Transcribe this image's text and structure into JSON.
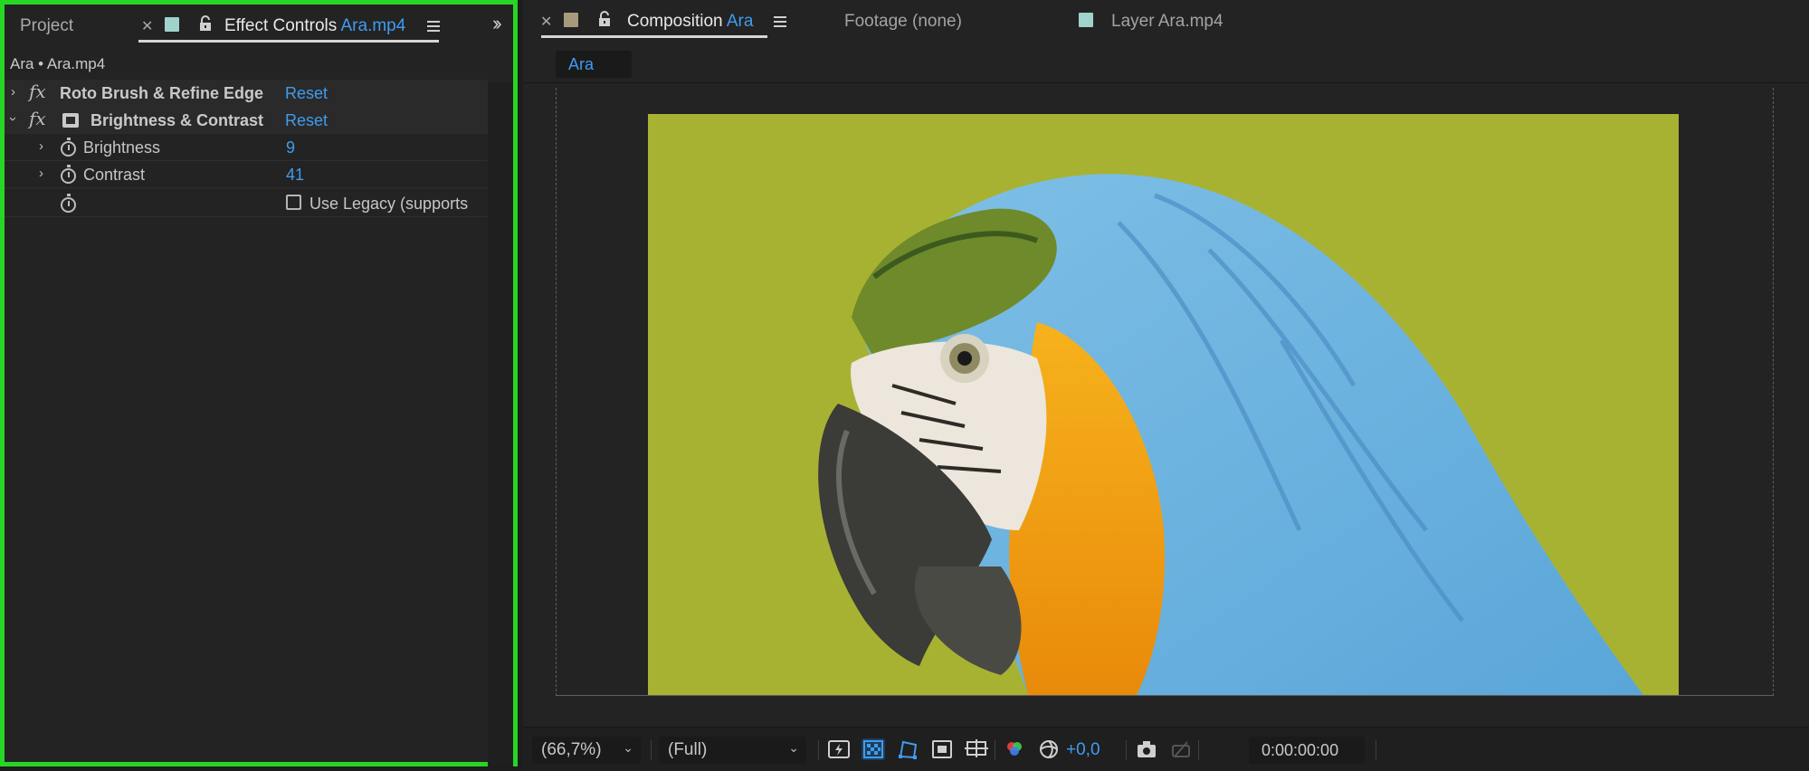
{
  "left_panel": {
    "project_tab": "Project",
    "active_tab": {
      "label": "Effect Controls",
      "file": "Ara.mp4"
    },
    "subject": "Ara • Ara.mp4",
    "effects": [
      {
        "name": "Roto Brush & Refine Edge",
        "reset": "Reset",
        "expanded": false
      },
      {
        "name": "Brightness & Contrast",
        "reset": "Reset",
        "expanded": true
      }
    ],
    "params": [
      {
        "name": "Brightness",
        "value": "9"
      },
      {
        "name": "Contrast",
        "value": "41"
      }
    ],
    "legacy_checkbox": {
      "label": "Use Legacy (supports",
      "checked": false
    }
  },
  "right_panel": {
    "composition_tab": {
      "label": "Composition",
      "name": "Ara"
    },
    "footage_tab": "Footage (none)",
    "layer_tab": "Layer Ara.mp4",
    "breadcrumb": "Ara"
  },
  "viewer_bar": {
    "zoom": "(66,7%)",
    "resolution": "(Full)",
    "exposure": "+0,0",
    "timecode": "0:00:00:00"
  },
  "colors": {
    "accent_blue": "#3f9cf0",
    "selection_outline": "#27d625",
    "comp_background": "#a8b232",
    "effect_controls_swatch": "#9fd3cc",
    "composition_swatch": "#a89a7c"
  }
}
